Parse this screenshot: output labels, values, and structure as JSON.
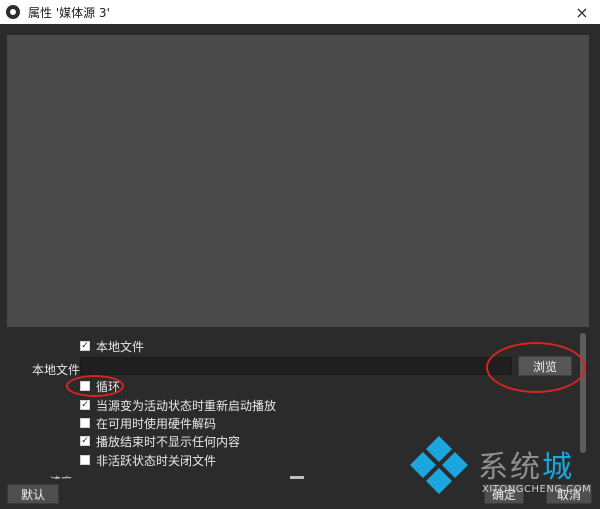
{
  "window": {
    "title": "属性 '媒体源 3'",
    "close_icon": "×"
  },
  "properties": {
    "local_file_checkbox": {
      "label": "本地文件",
      "checked": true
    },
    "local_file_field": {
      "label": "本地文件",
      "value": ""
    },
    "browse_label": "浏览",
    "options": [
      {
        "label": "循环",
        "checked": false
      },
      {
        "label": "当源变为活动状态时重新启动播放",
        "checked": true
      },
      {
        "label": "在可用时使用硬件解码",
        "checked": false
      },
      {
        "label": "播放结束时不显示任何内容",
        "checked": true
      },
      {
        "label": "非活跃状态时关闭文件",
        "checked": false
      }
    ],
    "partially_hidden_label": "速度"
  },
  "footer": {
    "defaults_label": "默认",
    "ok_label": "确定",
    "cancel_label": "取消"
  },
  "watermark": {
    "text_1": "系统",
    "text_2": "城",
    "url": "XITONGCHENG.COM"
  },
  "colors": {
    "annotation_red": "#d9241f",
    "watermark_blue": "#1ba6e0",
    "preview_bg": "#4a4a4a"
  }
}
